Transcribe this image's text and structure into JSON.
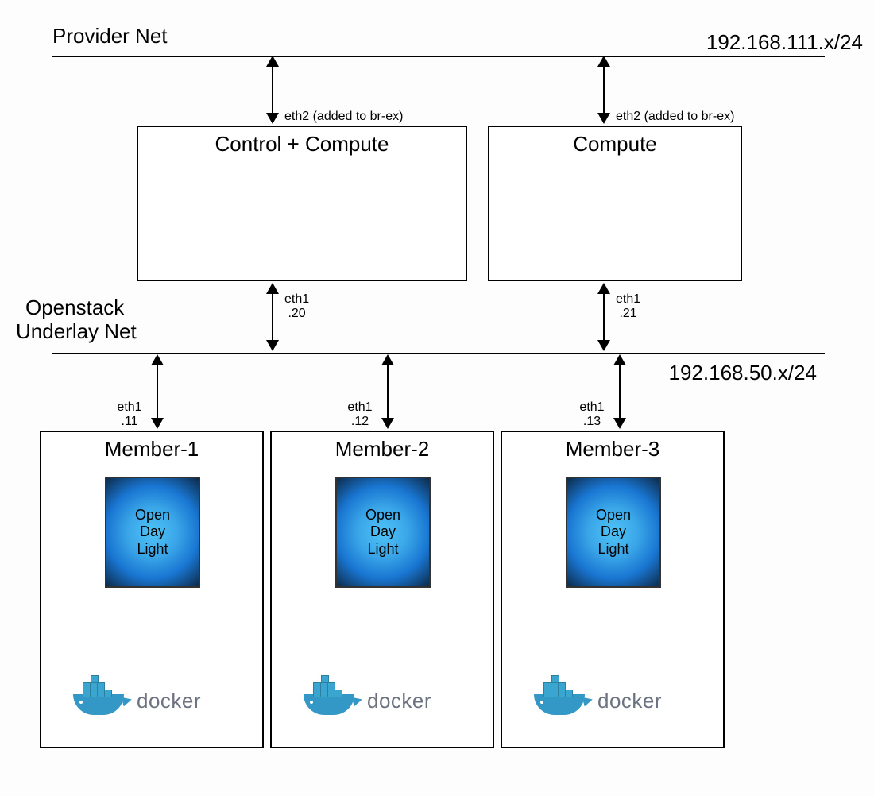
{
  "networks": {
    "provider": {
      "label": "Provider Net",
      "cidr": "192.168.111.x/24"
    },
    "underlay": {
      "label_line1": "Openstack",
      "label_line2": "Underlay Net",
      "cidr": "192.168.50.x/24"
    }
  },
  "top_nodes": {
    "control": {
      "title": "Control + Compute",
      "top_iface": "eth2 (added to br-ex)",
      "bottom_iface": "eth1",
      "bottom_addr": ".20"
    },
    "compute": {
      "title": "Compute",
      "top_iface": "eth2 (added to br-ex)",
      "bottom_iface": "eth1",
      "bottom_addr": ".21"
    }
  },
  "members": [
    {
      "title": "Member-1",
      "iface": "eth1",
      "addr": ".11",
      "app_line1": "Open",
      "app_line2": "Day",
      "app_line3": "Light",
      "runtime": "docker"
    },
    {
      "title": "Member-2",
      "iface": "eth1",
      "addr": ".12",
      "app_line1": "Open",
      "app_line2": "Day",
      "app_line3": "Light",
      "runtime": "docker"
    },
    {
      "title": "Member-3",
      "iface": "eth1",
      "addr": ".13",
      "app_line1": "Open",
      "app_line2": "Day",
      "app_line3": "Light",
      "runtime": "docker"
    }
  ]
}
